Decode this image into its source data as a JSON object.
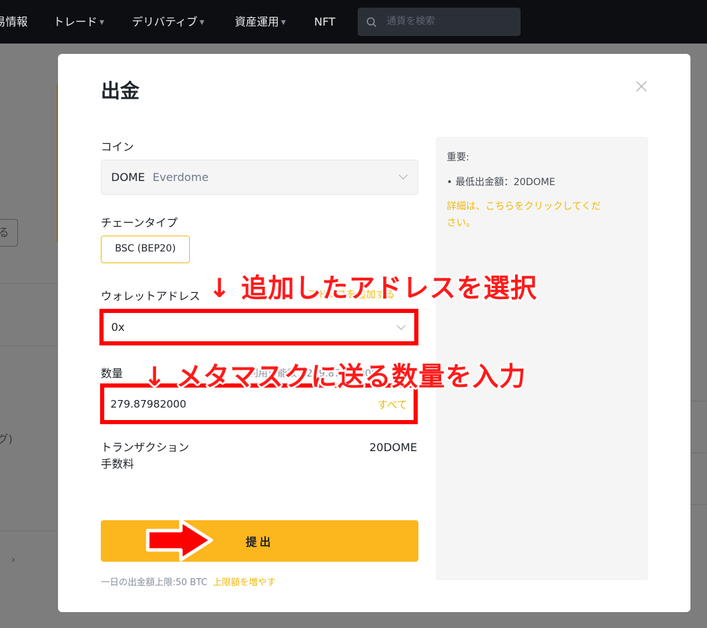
{
  "nav": {
    "items": [
      {
        "label": "易情報",
        "caret": false
      },
      {
        "label": "トレード",
        "caret": true
      },
      {
        "label": "デリバティブ",
        "caret": true
      },
      {
        "label": "資産運用",
        "caret": true
      },
      {
        "label": "NFT",
        "caret": false
      }
    ],
    "caret_glyph": "▼",
    "search_placeholder": "通貨を検索"
  },
  "background": {
    "button_fragment": "る",
    "text_fragment": "グ)",
    "chevron": "›"
  },
  "modal": {
    "title": "出金",
    "coin": {
      "label": "コイン",
      "symbol": "DOME",
      "name": "Everdome"
    },
    "chain": {
      "label": "チェーンタイプ",
      "selected": "BSC (BEP20)"
    },
    "address": {
      "label": "ウォレットアドレス",
      "add_link": "アドレスを追加する",
      "value": "0x"
    },
    "amount": {
      "label": "数量",
      "available": "利用可能数：279.87982000",
      "value": "279.87982000",
      "all_label": "すべて"
    },
    "fee": {
      "label_line1": "トランザクション",
      "label_line2": "手数料",
      "value": "20DOME"
    },
    "submit_label": "提出",
    "limit": {
      "text": "一日の出金額上限:50 BTC",
      "link": "上限額を増やす"
    }
  },
  "info_panel": {
    "heading": "重要:",
    "items": [
      "• 最低出金額：20DOME"
    ],
    "link": "詳細は、こちらをクリックしてください。"
  },
  "annotations": {
    "address_note": "↓ 追加したアドレスを選択",
    "amount_note": "↓ メタマスクに送る数量を入力",
    "color": "#ff0000"
  }
}
